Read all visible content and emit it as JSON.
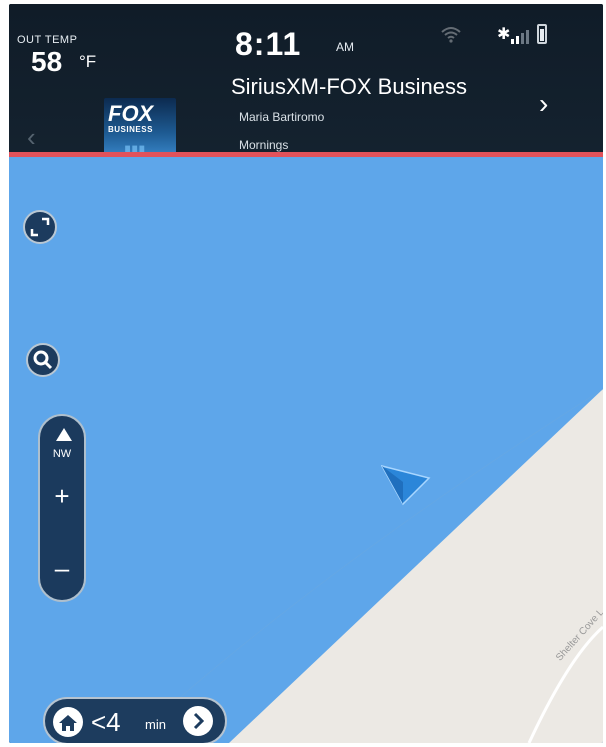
{
  "status": {
    "out_temp_label": "OUT TEMP",
    "out_temp_value": "58",
    "out_temp_unit": "°F",
    "time": "8:11",
    "ampm": "AM",
    "icons": [
      "wifi-icon",
      "bluetooth-icon",
      "signal-icon",
      "battery-icon"
    ]
  },
  "media": {
    "station_name": "SiriusXM-FOX Business",
    "host": "Maria Bartiromo",
    "show": "Mornings",
    "logo_text": "FOX",
    "logo_subtext": "BUSINESS",
    "page_count": 5,
    "active_page": 1
  },
  "map": {
    "compass_heading": "NW",
    "zoom_in_label": "+",
    "zoom_out_label": "–",
    "street_label": "Shelter Cove L",
    "eta_value": "<4",
    "eta_unit": "min"
  },
  "colors": {
    "water": "#5ea6ea",
    "land": "#ece9e4",
    "accent_divider": "#e1525b",
    "vehicle_arrow": "#2b86d9",
    "control_bg": "#1c3b5e"
  }
}
